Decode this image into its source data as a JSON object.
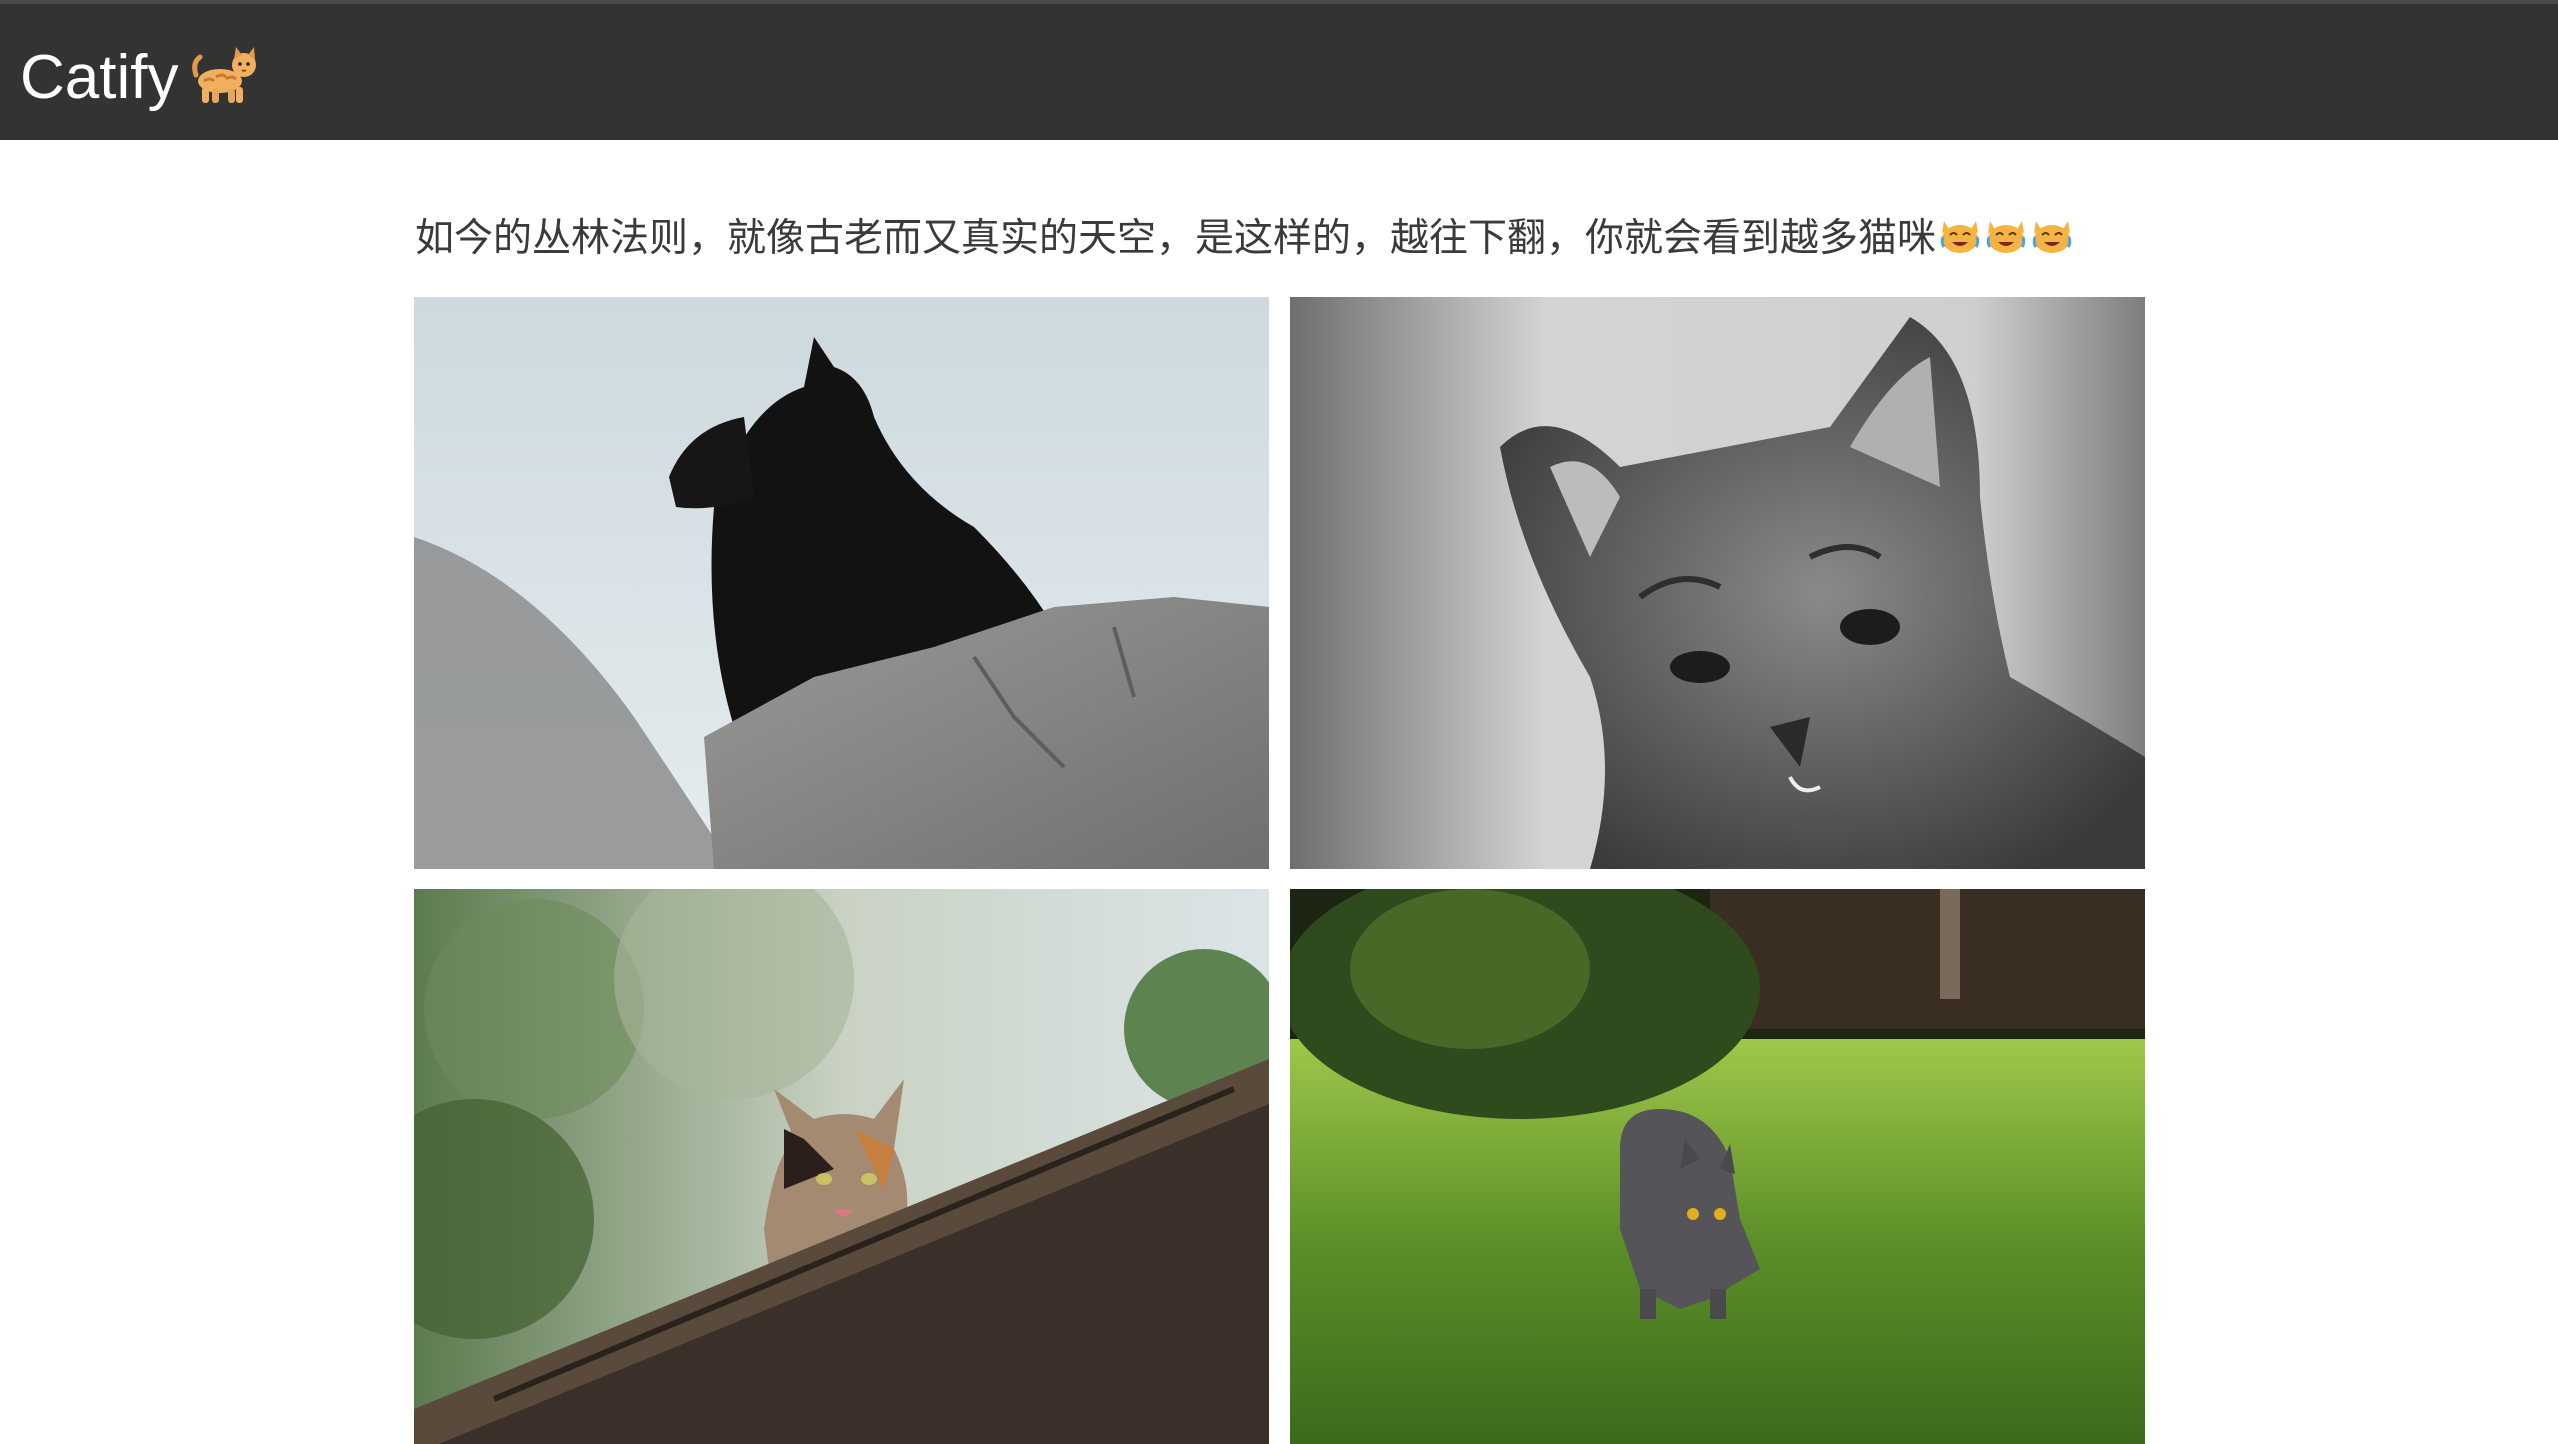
{
  "navbar": {
    "brand_text": "Catify",
    "brand_icon": "cat-emoji-icon"
  },
  "intro": {
    "text": "如今的丛林法则，就像古老而又真实的天空，是这样的，越往下翻，你就会看到越多猫咪",
    "emoji_icon": "crying-laughing-cat-icon",
    "emoji_count": 3
  },
  "photos": [
    {
      "subject": "black cat on rock"
    },
    {
      "subject": "tabby kitten black and white"
    },
    {
      "subject": "calico cat on roof"
    },
    {
      "subject": "grey cat on grass"
    }
  ],
  "colors": {
    "navbar_bg": "#333333",
    "navbar_text": "#ffffff",
    "body_text": "#3a3a3a",
    "page_bg": "#ffffff"
  }
}
